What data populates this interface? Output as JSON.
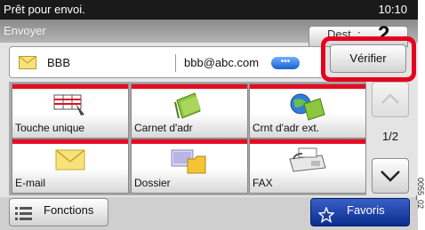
{
  "status_bar": {
    "message": "Prêt pour envoi.",
    "time": "10:10"
  },
  "title_bar": {
    "title": "Envoyer"
  },
  "dest_tab": {
    "label": "Dest. :",
    "count": "2"
  },
  "destination": {
    "name": "BBB",
    "email": "bbb@abc.com",
    "more_label": "•••"
  },
  "verify_button": {
    "label": "Vérifier"
  },
  "tiles": [
    {
      "label": "Touche unique",
      "icon": "one-touch-key-icon"
    },
    {
      "label": "Carnet d'adr",
      "icon": "address-book-icon"
    },
    {
      "label": "Crnt d'adr ext.",
      "icon": "external-address-book-icon"
    },
    {
      "label": "E-mail",
      "icon": "envelope-icon"
    },
    {
      "label": "Dossier",
      "icon": "folder-icon"
    },
    {
      "label": "FAX",
      "icon": "fax-icon"
    }
  ],
  "pager": {
    "page": "1/2"
  },
  "bottom": {
    "fonctions_label": "Fonctions",
    "favoris_label": "Favoris"
  },
  "image_code": "0055_02",
  "colors": {
    "accent_red": "#e60c22",
    "highlight_red": "#e6001e",
    "favoris_blue": "#0a2e8c",
    "status_bg": "#1a1a1a"
  }
}
